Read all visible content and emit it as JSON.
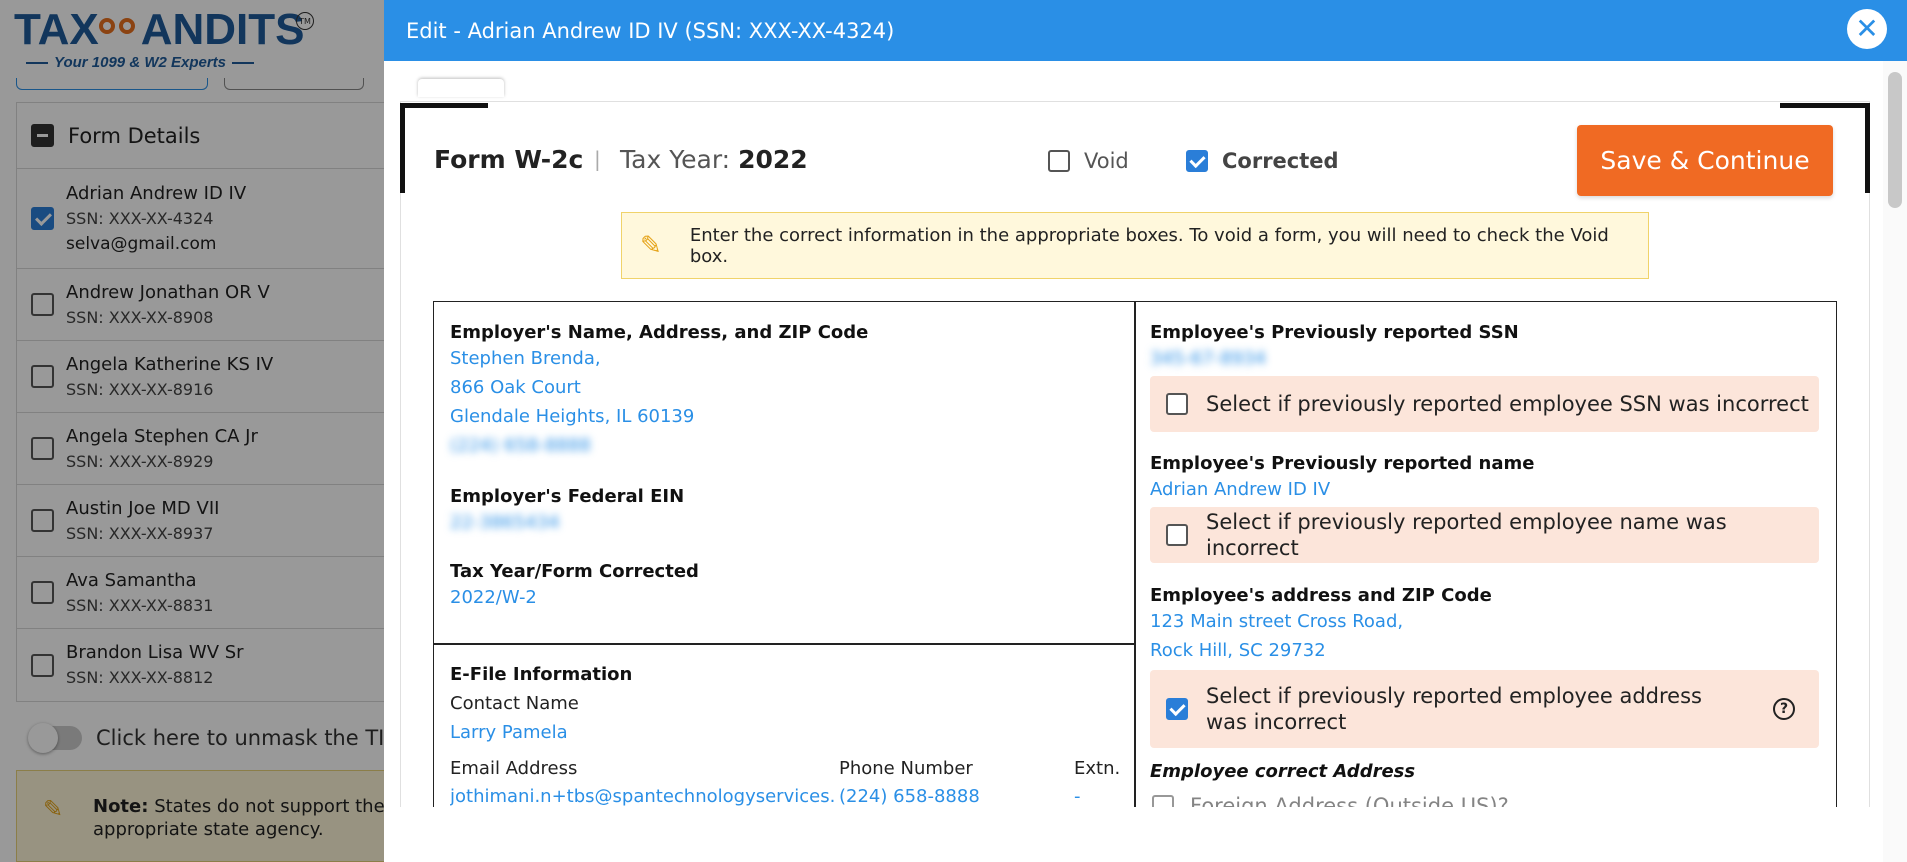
{
  "brand": {
    "logo_text_left": "TAX",
    "logo_text_right": "ANDITS",
    "trademark": "TM",
    "tagline": "Your 1099 & W2 Experts",
    "accent_color": "#f06a23",
    "primary_color": "#2a8fe6"
  },
  "recipient_list": {
    "header": "Form Details",
    "items": [
      {
        "name": "Adrian Andrew ID IV",
        "ssn": "SSN: XXX-XX-4324",
        "email": "selva@gmail.com",
        "checked": true
      },
      {
        "name": "Andrew Jonathan OR V",
        "ssn": "SSN: XXX-XX-8908",
        "checked": false
      },
      {
        "name": "Angela Katherine KS IV",
        "ssn": "SSN: XXX-XX-8916",
        "checked": false
      },
      {
        "name": "Angela Stephen CA Jr",
        "ssn": "SSN: XXX-XX-8929",
        "checked": false
      },
      {
        "name": "Austin Joe MD VII",
        "ssn": "SSN: XXX-XX-8937",
        "checked": false
      },
      {
        "name": "Ava Samantha",
        "ssn": "SSN: XXX-XX-8831",
        "checked": false
      },
      {
        "name": "Brandon Lisa WV Sr",
        "ssn": "SSN: XXX-XX-8812",
        "checked": false
      }
    ],
    "unmask_label": "Click here to unmask the TIN",
    "note_label": "Note:",
    "note_text_1": "States do not support the e",
    "note_text_2": "appropriate state agency."
  },
  "modal": {
    "title": "Edit - Adrian Andrew ID IV (SSN: XXX-XX-4324)",
    "close_symbol": "✕",
    "form_name": "Form W-2c",
    "separator": "|",
    "tax_year_label": "Tax Year:",
    "tax_year_value": "2022",
    "void_label": "Void",
    "void_checked": false,
    "corrected_label": "Corrected",
    "corrected_checked": true,
    "save_button": "Save & Continue",
    "info_text": "Enter the correct information in the appropriate boxes. To void a form, you will need to check the Void box."
  },
  "employer": {
    "name_address_label": "Employer's Name, Address, and ZIP Code",
    "name": "Stephen Brenda,",
    "address1": "866 Oak Court",
    "address2": "Glendale Heights, IL 60139",
    "phone": "(224) 658-8888",
    "ein_label": "Employer's Federal EIN",
    "ein": "22-3865434",
    "corrected_label": "Tax Year/Form Corrected",
    "corrected_value": "2022/W-2"
  },
  "efile": {
    "label": "E-File Information",
    "contact_name_label": "Contact Name",
    "contact_name": "Larry Pamela",
    "email_label": "Email Address",
    "email": "jothimani.n+tbs@spantechnologyservices.c",
    "phone_label": "Phone Number",
    "phone": "(224) 658-8888",
    "extn_label": "Extn.",
    "extn": "-"
  },
  "employee": {
    "prev_ssn_label": "Employee's Previously reported SSN",
    "prev_ssn": "345-67-8934",
    "ssn_incorrect_label": "Select if previously reported employee SSN was incorrect",
    "ssn_incorrect_checked": false,
    "prev_name_label": "Employee's Previously reported name",
    "prev_name": "Adrian Andrew ID IV",
    "name_incorrect_label": "Select if previously reported employee name was incorrect",
    "name_incorrect_checked": false,
    "address_label": "Employee's address and ZIP Code",
    "address1": "123 Main street Cross Road,",
    "address2": "Rock Hill, SC 29732",
    "address_incorrect_label": "Select if previously reported employee address was incorrect",
    "address_incorrect_checked": true,
    "help_symbol": "?",
    "correct_address_label": "Employee correct Address",
    "foreign_label": "Foreign Address (Outside US)?"
  }
}
